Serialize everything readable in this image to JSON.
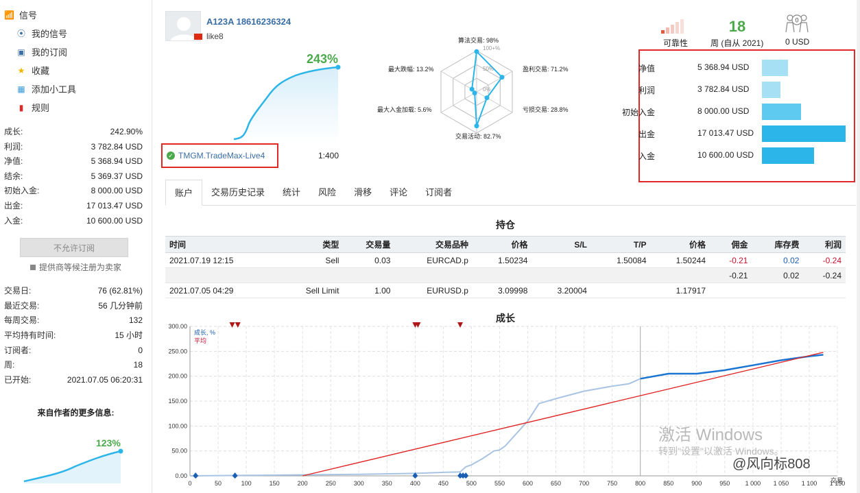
{
  "sidebar": {
    "root_label": "信号",
    "items": [
      {
        "label": "我的信号",
        "icon": "signal-icon"
      },
      {
        "label": "我的订阅",
        "icon": "subscription-icon"
      },
      {
        "label": "收藏",
        "icon": "star-icon"
      },
      {
        "label": "添加小工具",
        "icon": "widget-icon"
      },
      {
        "label": "规则",
        "icon": "bookmark-icon"
      }
    ],
    "stats": [
      {
        "k": "成长:",
        "v": "242.90%"
      },
      {
        "k": "利润:",
        "v": "3 782.84 USD"
      },
      {
        "k": "净值:",
        "v": "5 368.94 USD"
      },
      {
        "k": "结余:",
        "v": "5 369.37 USD"
      },
      {
        "k": "初始入金:",
        "v": "8 000.00 USD"
      },
      {
        "k": "出金:",
        "v": "17 013.47 USD"
      },
      {
        "k": "入金:",
        "v": "10 600.00 USD"
      }
    ],
    "no_subscribe_label": "不允许订阅",
    "provider_note": "提供商等候注册为卖家",
    "stats2": [
      {
        "k": "交易日:",
        "v": "76 (62.81%)"
      },
      {
        "k": "最近交易:",
        "v": "56 几分钟前"
      },
      {
        "k": "每周交易:",
        "v": "132"
      },
      {
        "k": "平均持有时间:",
        "v": "15 小时"
      },
      {
        "k": "订阅者:",
        "v": "0"
      },
      {
        "k": "周:",
        "v": "18"
      },
      {
        "k": "已开始:",
        "v": "2021.07.05 06:20:31"
      }
    ],
    "more_title": "来自作者的更多信息:",
    "more_pct": "123%"
  },
  "header": {
    "name": "A123A 18616236324",
    "login": "like8",
    "growth": "243%",
    "broker": "TMGM.TradeMax-Live4",
    "leverage": "1:400"
  },
  "radar": {
    "labels": [
      "算法交易: 98%",
      "盈利交易: 71.2%",
      "亏损交易: 28.8%",
      "交易活动: 82.7%",
      "最大入金加载: 5.6%",
      "最大跌幅: 13.2%"
    ],
    "values": [
      98,
      71.2,
      28.8,
      82.7,
      5.6,
      13.2
    ],
    "rings": [
      "100+%",
      "50%",
      "0%"
    ]
  },
  "stats_top": {
    "reliability_label": "可靠性",
    "weeks": "18",
    "weeks_label": "周 (自从 2021)",
    "subs_count": "0",
    "subs_label": "0 USD"
  },
  "summary": [
    {
      "k": "净值",
      "v": "5 368.94 USD",
      "value": 5368.94
    },
    {
      "k": "利润",
      "v": "3 782.84 USD",
      "value": 3782.84
    },
    {
      "k": "初始入金",
      "v": "8 000.00 USD",
      "value": 8000.0
    },
    {
      "k": "出金",
      "v": "17 013.47 USD",
      "value": 17013.47
    },
    {
      "k": "入金",
      "v": "10 600.00 USD",
      "value": 10600.0
    }
  ],
  "tabs": [
    "账户",
    "交易历史记录",
    "统计",
    "风险",
    "滑移",
    "评论",
    "订阅者"
  ],
  "positions": {
    "title": "持仓",
    "headers": [
      "时间",
      "类型",
      "交易量",
      "交易品种",
      "价格",
      "S/L",
      "T/P",
      "价格",
      "佣金",
      "库存费",
      "利润"
    ],
    "row1": [
      "2021.07.19 12:15",
      "Sell",
      "0.03",
      "EURCAD.p",
      "1.50234",
      "",
      "1.50084",
      "1.50244",
      "-0.21",
      "0.02",
      "-0.24"
    ],
    "sum": [
      "-0.21",
      "0.02",
      "-0.24"
    ],
    "row2": [
      "2021.07.05 04:29",
      "Sell Limit",
      "1.00",
      "EURUSD.p",
      "3.09998",
      "3.20004",
      "",
      "1.17917",
      "",
      "",
      ""
    ]
  },
  "growth": {
    "title": "成长",
    "legend_growth": "成长, %",
    "legend_avg": "平均",
    "x_caption": "交易",
    "watermark_1": "激活 Windows",
    "watermark_2": "转到\"设置\"以激活 Windows。",
    "watermark_3": "@风向标808"
  },
  "chart_data": {
    "type": "line",
    "xlabel": "交易",
    "ylabel": "",
    "xlim": [
      0,
      1150
    ],
    "ylim": [
      0,
      300
    ],
    "x_ticks": [
      0,
      50,
      100,
      150,
      200,
      250,
      300,
      350,
      400,
      450,
      500,
      550,
      600,
      650,
      700,
      750,
      800,
      850,
      900,
      950,
      1000,
      1050,
      1100,
      1150
    ],
    "x_tick_labels": [
      "0",
      "50",
      "100",
      "150",
      "200",
      "250",
      "300",
      "350",
      "400",
      "450",
      "500",
      "550",
      "600",
      "650",
      "700",
      "750",
      "800",
      "850",
      "900",
      "950",
      "1 000",
      "1 050",
      "1 100",
      "1 150"
    ],
    "y_ticks": [
      "0.00",
      "50.00",
      "100.00",
      "150.00",
      "200.00",
      "250.00",
      "300.00"
    ],
    "series": [
      {
        "name": "成长, %",
        "x": [
          0,
          100,
          200,
          300,
          400,
          450,
          480,
          490,
          500,
          520,
          540,
          550,
          560,
          600,
          620,
          650,
          700,
          750,
          780,
          800,
          850,
          900,
          950,
          1000,
          1050,
          1100,
          1125
        ],
        "y": [
          0,
          1,
          2,
          3,
          5,
          7,
          8,
          18,
          22,
          35,
          50,
          52,
          60,
          110,
          145,
          155,
          170,
          180,
          185,
          195,
          205,
          205,
          212,
          222,
          232,
          240,
          243
        ]
      },
      {
        "name": "平均",
        "x": [
          200,
          1125
        ],
        "y": [
          0,
          248
        ]
      }
    ],
    "marker_x_top": [
      75,
      85,
      400,
      405,
      480
    ],
    "marker_x_bottom": [
      10,
      80,
      400,
      480,
      485,
      490
    ]
  },
  "colors": {
    "accent": "#3a6ea5",
    "green": "#4aa94a",
    "red": "#e02828",
    "bar_light": "#a6e0f5",
    "bar_dark": "#2bb5e8"
  }
}
